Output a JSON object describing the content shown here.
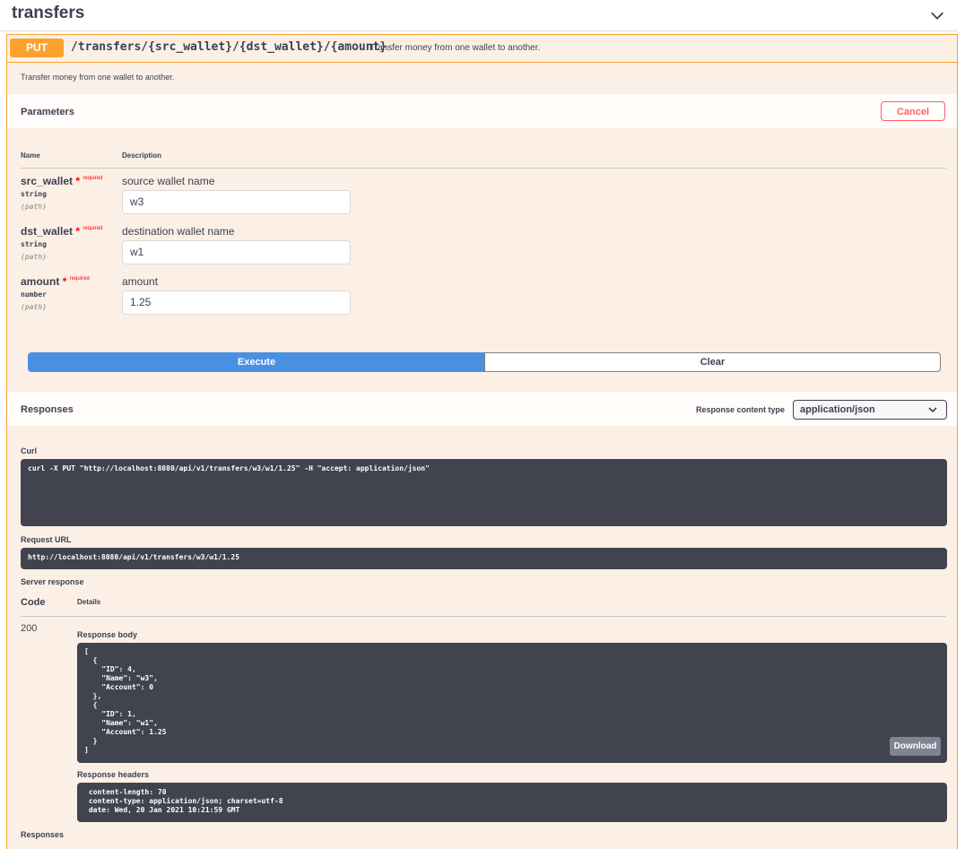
{
  "tag": {
    "title": "transfers"
  },
  "operation": {
    "method": "PUT",
    "path": "/transfers/{src_wallet}/{dst_wallet}/{amount}",
    "summary": "Transfer money from one wallet to another.",
    "description": "Transfer money from one wallet to another."
  },
  "parameters": {
    "title": "Parameters",
    "cancel_label": "Cancel",
    "col_name": "Name",
    "col_description": "Description",
    "items": [
      {
        "name": "src_wallet",
        "required_star": "*",
        "required_label": "required",
        "type": "string",
        "in": "(path)",
        "description": "source wallet name",
        "value": "w3"
      },
      {
        "name": "dst_wallet",
        "required_star": "*",
        "required_label": "required",
        "type": "string",
        "in": "(path)",
        "description": "destination wallet name",
        "value": "w1"
      },
      {
        "name": "amount",
        "required_star": "*",
        "required_label": "required",
        "type": "number",
        "in": "(path)",
        "description": "amount",
        "value": "1.25"
      }
    ]
  },
  "actions": {
    "execute_label": "Execute",
    "clear_label": "Clear"
  },
  "responses": {
    "title": "Responses",
    "content_type_label": "Response content type",
    "content_type_value": "application/json",
    "curl_label": "Curl",
    "curl": "curl -X PUT \"http://localhost:8080/api/v1/transfers/w3/w1/1.25\" -H \"accept: application/json\"",
    "request_url_label": "Request URL",
    "request_url": "http://localhost:8080/api/v1/transfers/w3/w1/1.25",
    "server_response_label": "Server response",
    "col_code": "Code",
    "col_details": "Details",
    "code": "200",
    "body_label": "Response body",
    "body": "[\n  {\n    \"ID\": 4,\n    \"Name\": \"w3\",\n    \"Account\": 0\n  },\n  {\n    \"ID\": 1,\n    \"Name\": \"w1\",\n    \"Account\": 1.25\n  }\n]",
    "download_label": "Download",
    "headers_label": "Response headers",
    "headers": " content-length: 70 \n content-type: application/json; charset=utf-8 \n date: Wed, 20 Jan 2021 10:21:59 GMT ",
    "footer_title": "Responses"
  },
  "colors": {
    "put": "#fca130",
    "execute": "#4990e2",
    "cancel": "#ff6060",
    "code_bg": "#41444e"
  },
  "icons": {
    "collapse": "chevron-down-icon",
    "select": "chevron-down-icon"
  }
}
